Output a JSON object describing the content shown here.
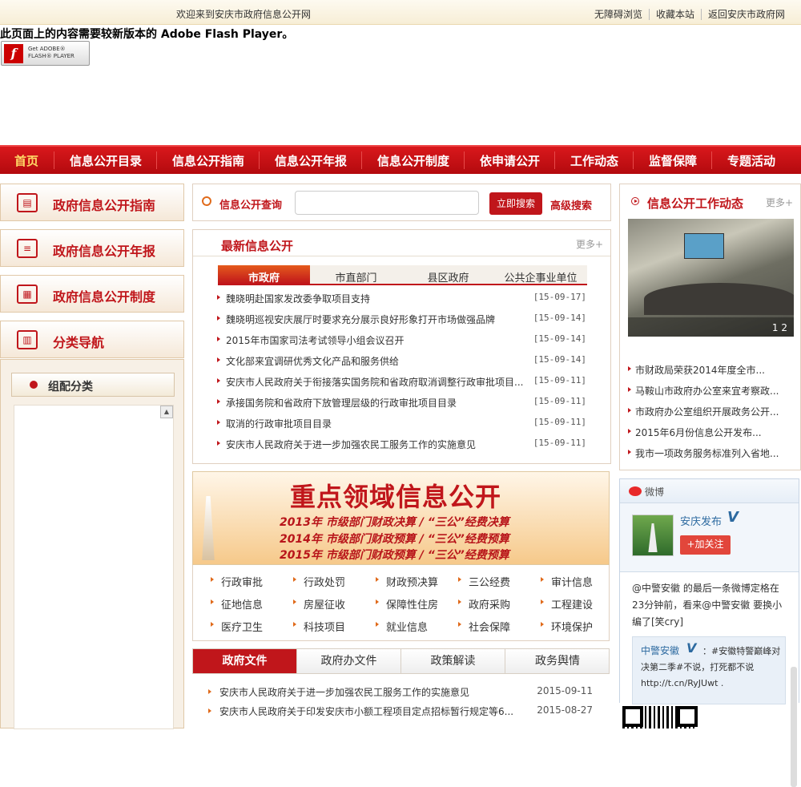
{
  "topbar": {
    "welcome": "欢迎来到安庆市政府信息公开网",
    "links": [
      "无障碍浏览",
      "收藏本站",
      "返回安庆市政府网"
    ]
  },
  "flash": {
    "message": "此页面上的内容需要较新版本的  Adobe Flash Player。",
    "badge_line1": "Get ADOBE®",
    "badge_line2": "FLASH® PLAYER"
  },
  "nav": [
    "首页",
    "信息公开目录",
    "信息公开指南",
    "信息公开年报",
    "信息公开制度",
    "依申请公开",
    "工作动态",
    "监督保障",
    "专题活动"
  ],
  "left": {
    "items": [
      "政府信息公开指南",
      "政府信息公开年报",
      "政府信息公开制度",
      "分类导航"
    ],
    "category_button": "组配分类"
  },
  "search": {
    "label": "信息公开查询",
    "placeholder": "",
    "button": "立即搜索",
    "advanced": "高级搜索"
  },
  "latest": {
    "title": "最新信息公开",
    "more": "更多+",
    "tabs": [
      "市政府",
      "市直部门",
      "县区政府",
      "公共企事业单位"
    ],
    "items": [
      {
        "text": "魏晓明赴国家发改委争取项目支持",
        "date": "[15-09-17]"
      },
      {
        "text": "魏晓明巡视安庆展厅时要求充分展示良好形象打开市场做强品牌",
        "date": "[15-09-14]"
      },
      {
        "text": "2015年市国家司法考试领导小组会议召开",
        "date": "[15-09-14]"
      },
      {
        "text": "文化部来宜调研优秀文化产品和服务供给",
        "date": "[15-09-14]"
      },
      {
        "text": "安庆市人民政府关于衔接落实国务院和省政府取消调整行政审批项目...",
        "date": "[15-09-11]"
      },
      {
        "text": "承接国务院和省政府下放管理层级的行政审批项目目录",
        "date": "[15-09-11]"
      },
      {
        "text": "取消的行政审批项目目录",
        "date": "[15-09-11]"
      },
      {
        "text": "安庆市人民政府关于进一步加强农民工服务工作的实施意见",
        "date": "[15-09-11]"
      }
    ]
  },
  "banner": {
    "title": "重点领域信息公开",
    "lines": [
      "2013年  市级部门财政决算 / “三公”经费决算",
      "2014年  市级部门财政预算 / “三公”经费预算",
      "2015年  市级部门财政预算 / “三公”经费预算"
    ]
  },
  "tags": [
    [
      "行政审批",
      "行政处罚",
      "财政预决算",
      "三公经费",
      "审计信息"
    ],
    [
      "征地信息",
      "房屋征收",
      "保障性住房",
      "政府采购",
      "工程建设"
    ],
    [
      "医疗卫生",
      "科技项目",
      "就业信息",
      "社会保障",
      "环境保护"
    ]
  ],
  "docs": {
    "tabs": [
      "政府文件",
      "政府办文件",
      "政策解读",
      "政务舆情"
    ],
    "items": [
      {
        "text": "安庆市人民政府关于进一步加强农民工服务工作的实施意见",
        "date": "2015-09-11"
      },
      {
        "text": "安庆市人民政府关于印发安庆市小额工程项目定点招标暂行规定等6...",
        "date": "2015-08-27"
      }
    ]
  },
  "dynamics": {
    "title": "信息公开工作动态",
    "more": "更多+",
    "pager": "1  2",
    "items": [
      "市财政局荣获2014年度全市...",
      "马鞍山市政府办公室来宜考察政...",
      "市政府办公室组织开展政务公开...",
      "2015年6月份信息公开发布...",
      "我市一项政务服务标准列入省地..."
    ]
  },
  "weibo": {
    "title": "微博",
    "account": "安庆发布",
    "follow": "+加关注",
    "post": "@中警安徽 的最后一条微博定格在23分钟前，看来@中警安徽 要换小编了[笑cry]",
    "quote_name": "中警安徽",
    "quote_text": "：#安徽特警巅峰对决第二季#不说，打死都不说 http://t.cn/RyJUwt ."
  }
}
